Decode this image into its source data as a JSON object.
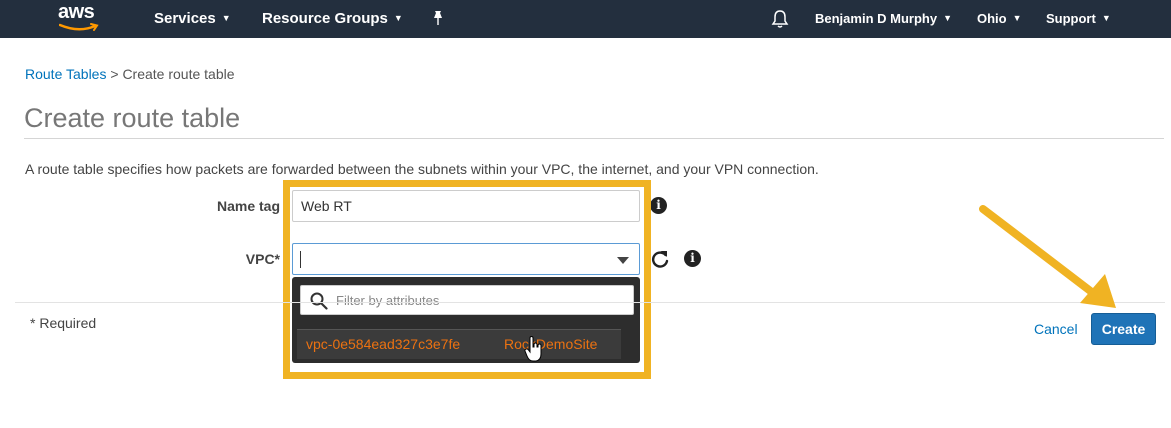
{
  "topnav": {
    "logo_text": "aws",
    "services_label": "Services",
    "resource_groups_label": "Resource Groups",
    "user_label": "Benjamin D Murphy",
    "region_label": "Ohio",
    "support_label": "Support"
  },
  "breadcrumb": {
    "parent_label": "Route Tables",
    "separator": " > ",
    "current_label": "Create route table"
  },
  "page": {
    "title": "Create route table",
    "description": "A route table specifies how packets are forwarded between the subnets within your VPC, the internet, and your VPN connection."
  },
  "form": {
    "name_tag_label": "Name tag",
    "name_tag_value": "Web RT",
    "vpc_label": "VPC*",
    "vpc_value": ""
  },
  "dropdown": {
    "filter_placeholder": "Filter by attributes",
    "options": [
      {
        "id": "vpc-0e584ead327c3e7fe",
        "name": "RockDemoSite"
      }
    ]
  },
  "footer": {
    "required_note": "* Required",
    "cancel_label": "Cancel",
    "create_label": "Create"
  },
  "colors": {
    "nav_bg": "#232f3e",
    "link": "#0073bb",
    "primary_button": "#1f73b7",
    "option_text": "#ec7211",
    "annotation": "#f0b323"
  },
  "icons": [
    "aws-logo-smile",
    "chevron-down-icon",
    "pin-icon",
    "bell-icon",
    "info-icon",
    "refresh-icon",
    "search-icon",
    "hand-cursor-icon",
    "arrow-annotation"
  ]
}
